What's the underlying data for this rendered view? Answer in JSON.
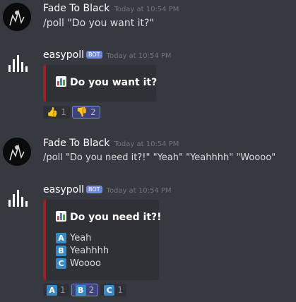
{
  "messages": [
    {
      "author": "Fade To Black",
      "timestamp": "Today at 10:54 PM",
      "content": "/poll \"Do you want it?\""
    },
    {
      "author": "easypoll",
      "bot_tag": "BOT",
      "timestamp": "Today at 10:54 PM",
      "embed": {
        "title": "Do you want it?"
      },
      "reactions": [
        {
          "emoji": "thumbs-up-icon",
          "count": "1"
        },
        {
          "emoji": "thumbs-down-icon",
          "count": "2"
        }
      ]
    },
    {
      "author": "Fade To Black",
      "timestamp": "Today at 10:54 PM",
      "content": "/poll \"Do you need it?!\" \"Yeah\" \"Yeahhhh\" \"Woooo\""
    },
    {
      "author": "easypoll",
      "bot_tag": "BOT",
      "timestamp": "Today at 10:54 PM",
      "embed": {
        "title": "Do you need it?!",
        "options": [
          {
            "letter": "A",
            "text": "Yeah"
          },
          {
            "letter": "B",
            "text": "Yeahhhh"
          },
          {
            "letter": "C",
            "text": "Woooo"
          }
        ]
      },
      "reactions": [
        {
          "letter": "A",
          "count": "1"
        },
        {
          "letter": "B",
          "count": "2"
        },
        {
          "letter": "C",
          "count": "1"
        }
      ]
    }
  ],
  "colors": {
    "background": "#36393f",
    "embed_bg": "#2f3136",
    "embed_border": "#9b2222",
    "bot_tag": "#7289da",
    "letter_badge": "#3b88c3"
  }
}
